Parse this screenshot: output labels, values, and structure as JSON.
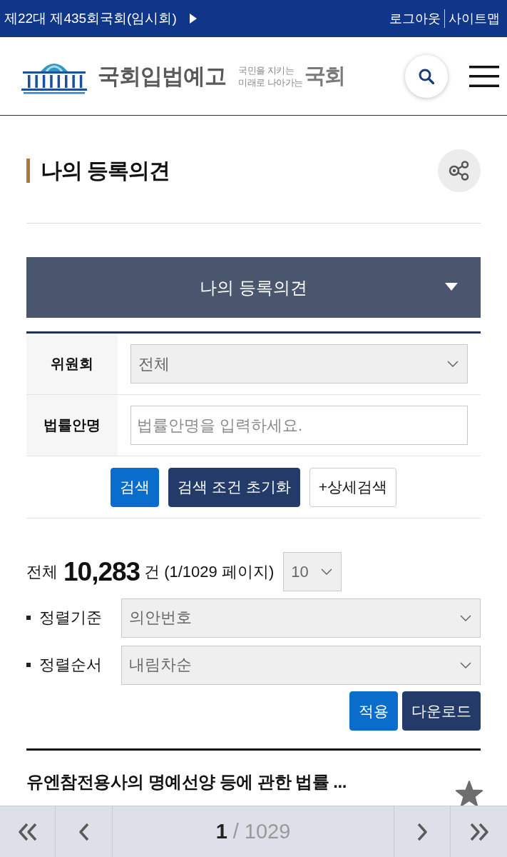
{
  "top_bar": {
    "session": "제22대 제435회국회(임시회)",
    "links": [
      "로그아웃",
      "사이트맵"
    ]
  },
  "header": {
    "logo": {
      "name": "국회입법예고",
      "slogan_lines": [
        "국민을 지키는",
        "미래로 나아가는"
      ],
      "slogan_mark": "국회"
    }
  },
  "page_title": "나의 등록의견",
  "menu_dropdown": {
    "label": "나의 등록의견",
    "expanded": false
  },
  "search_form": {
    "rows": [
      {
        "label": "위원회",
        "kind": "select",
        "value": "전체"
      },
      {
        "label": "법률안명",
        "kind": "text",
        "placeholder": "법률안명을 입력하세요."
      }
    ],
    "buttons": [
      {
        "label": "검색",
        "kind": "primary"
      },
      {
        "label": "검색 조건 초기화",
        "kind": "dark"
      },
      {
        "label": "+상세검색",
        "kind": "outline"
      }
    ]
  },
  "summary": {
    "total_label": "전체",
    "total": "10,283",
    "unit": "건",
    "pages": "(1/1029 페이지)",
    "page_size": "10"
  },
  "sort_options": [
    {
      "label": "정렬기준",
      "value": "의안번호"
    },
    {
      "label": "정렬순서",
      "value": "내림차순"
    }
  ],
  "action_buttons": [
    {
      "label": "적용",
      "kind": "primary"
    },
    {
      "label": "다운로드",
      "kind": "dark"
    }
  ],
  "results": [
    {
      "title": "유엔참전용사의 명예선양 등에 관한 법률 ...",
      "starred": false
    }
  ],
  "pagination": {
    "current": "1",
    "separator": "/",
    "total": "1029"
  }
}
